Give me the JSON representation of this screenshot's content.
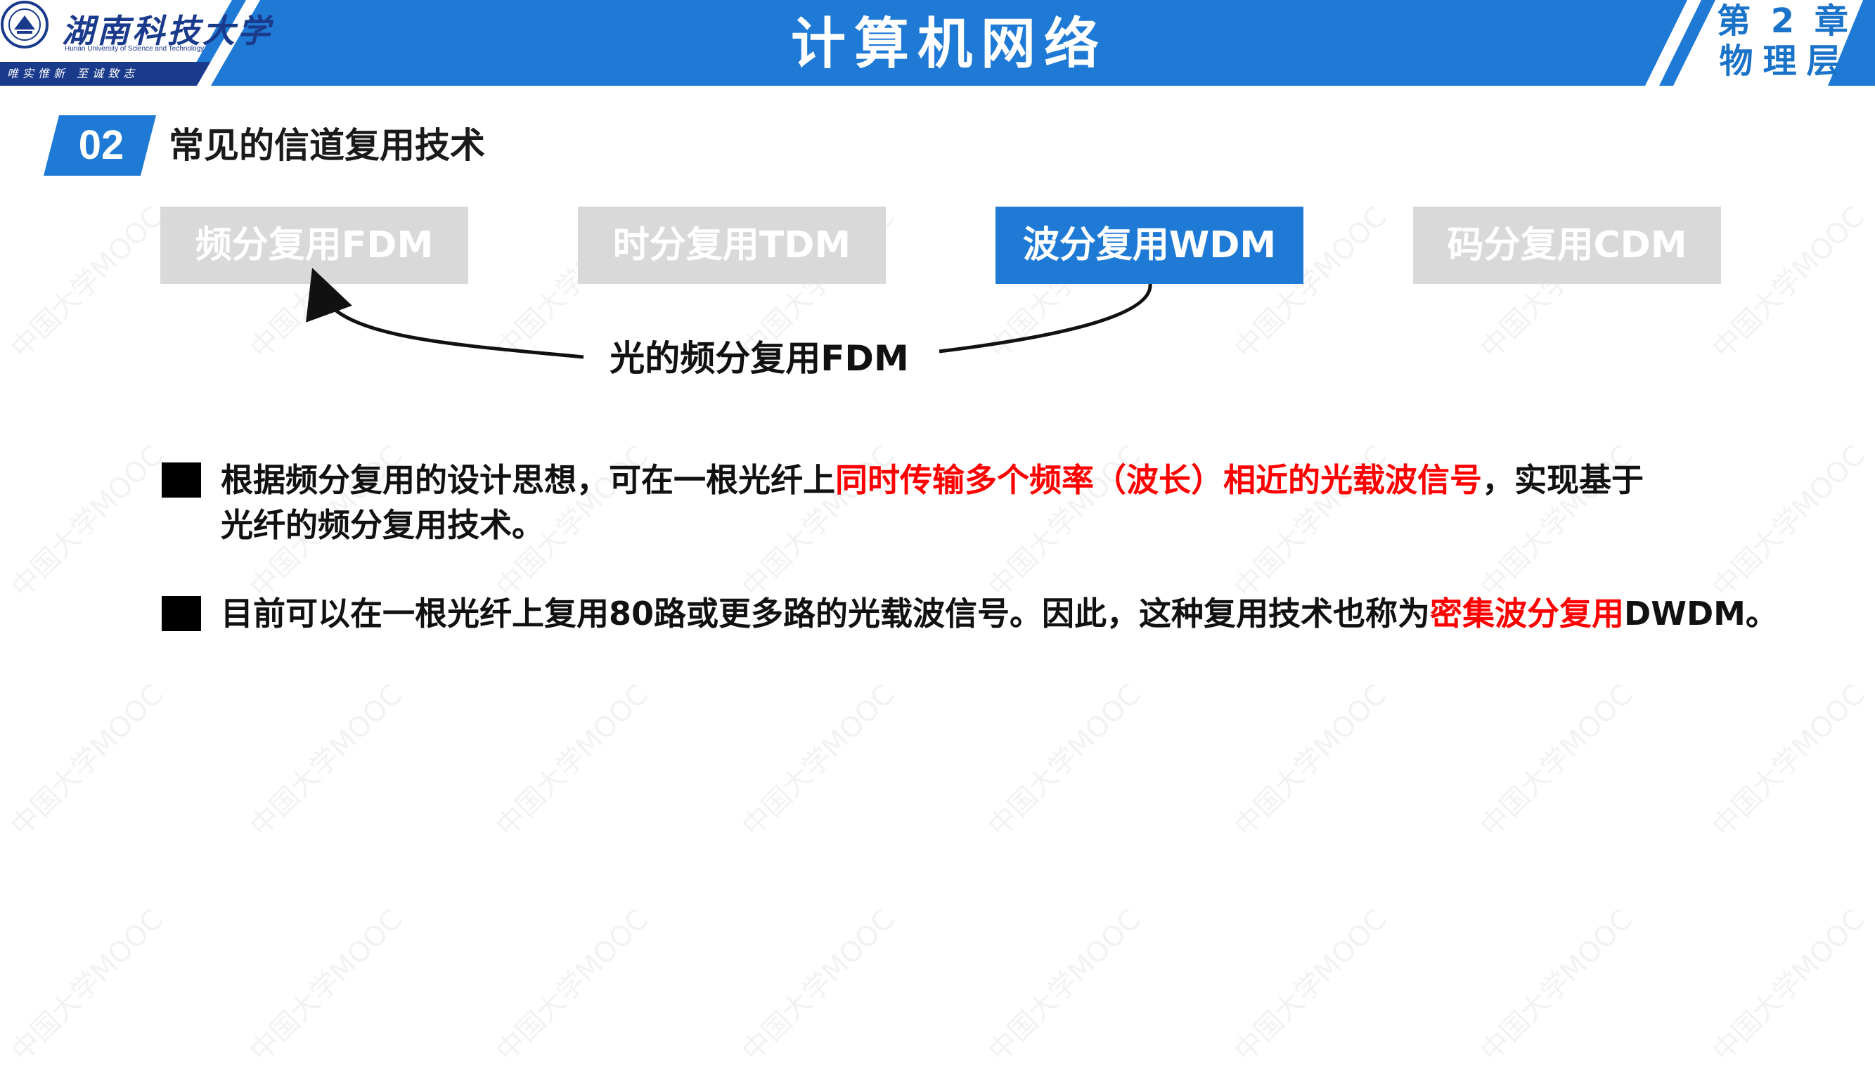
{
  "header": {
    "university_cn": "湖南科技大学",
    "university_en": "Hunan University of Science and Technology",
    "motto": "唯实惟新  至诚致志",
    "course_title": "计算机网络",
    "chapter_line1": "第 2 章",
    "chapter_line2": "物理层",
    "bar_color": "#1f7ad6"
  },
  "section": {
    "number": "02",
    "title": "常见的信道复用技术"
  },
  "tabs": [
    {
      "label": "频分复用FDM",
      "state": "inactive"
    },
    {
      "label": "时分复用TDM",
      "state": "inactive"
    },
    {
      "label": "波分复用WDM",
      "state": "active"
    },
    {
      "label": "码分复用CDM",
      "state": "inactive"
    }
  ],
  "arrow_label": "光的频分复用FDM",
  "bullets": [
    {
      "line1_a": "根据频分复用的设计思想，可在一根光纤上",
      "line1_highlight": "同时传输多个频率（波长）相近的光载波信号",
      "line1_b": "，实现基于",
      "line2": "光纤的频分复用技术。"
    },
    {
      "text_a": "目前可以在一根光纤上复用80路或更多路的光载波信号。因此，这种复用技术也称为",
      "highlight": "密集波分复用",
      "text_b": "DWDM。"
    }
  ],
  "watermark": "中国大学MOOC",
  "colors": {
    "accent": "#1f7ad6",
    "inactive_tab": "#d9d9d9",
    "highlight": "#ff0000"
  }
}
